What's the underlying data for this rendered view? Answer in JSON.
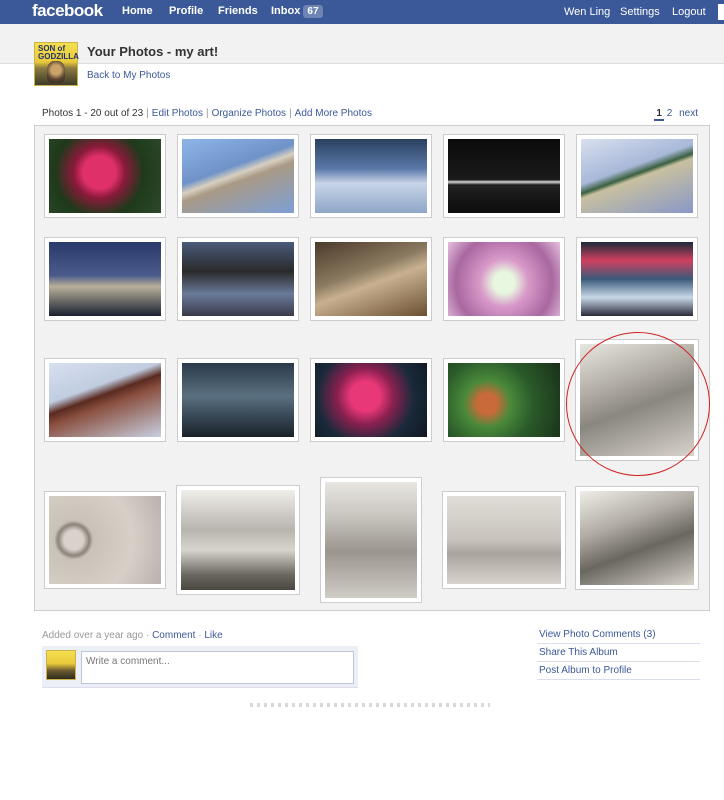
{
  "topbar": {
    "logo": "facebook",
    "nav": [
      "Home",
      "Profile",
      "Friends"
    ],
    "inbox_label": "Inbox",
    "inbox_count": "67",
    "user": "Wen Ling",
    "settings": "Settings",
    "logout": "Logout",
    "brand_color": "#3b5998"
  },
  "header": {
    "album_icon_text": "SON of GODZILLA",
    "title": "Your Photos - my art!",
    "back_link": "Back to My Photos"
  },
  "album_bar": {
    "count_text": "Photos 1 - 20 out of 23",
    "links": [
      "Edit Photos",
      "Organize Photos",
      "Add More Photos"
    ]
  },
  "pager": {
    "pages": [
      "1",
      "2"
    ],
    "current": "1",
    "next": "next"
  },
  "photos": [
    {
      "subject": "pink flower"
    },
    {
      "subject": "tree trunk and sky"
    },
    {
      "subject": "snowy branches"
    },
    {
      "subject": "piano keys"
    },
    {
      "subject": "colored pencils"
    },
    {
      "subject": "chess pieces"
    },
    {
      "subject": "chess pawn"
    },
    {
      "subject": "mug handle"
    },
    {
      "subject": "flower close-up"
    },
    {
      "subject": "flowers in vase by window"
    },
    {
      "subject": "dry leaf"
    },
    {
      "subject": "keyboard and touchpad"
    },
    {
      "subject": "pink flower"
    },
    {
      "subject": "green tomato on plant"
    },
    {
      "subject": "guitar pencil drawing",
      "highlighted": true
    },
    {
      "subject": "sphere pencil drawing"
    },
    {
      "subject": "boxes pencil drawing"
    },
    {
      "subject": "cup pencil drawing"
    },
    {
      "subject": "plate pencil drawing"
    },
    {
      "subject": "backpack pencil drawing"
    }
  ],
  "annotation_color": "#d02020",
  "footer": {
    "added": "Added over a year ago",
    "comment": "Comment",
    "like": "Like",
    "comment_placeholder": "Write a comment...",
    "side_links": [
      "View Photo Comments (3)",
      "Share This Album",
      "Post Album to Profile"
    ]
  }
}
